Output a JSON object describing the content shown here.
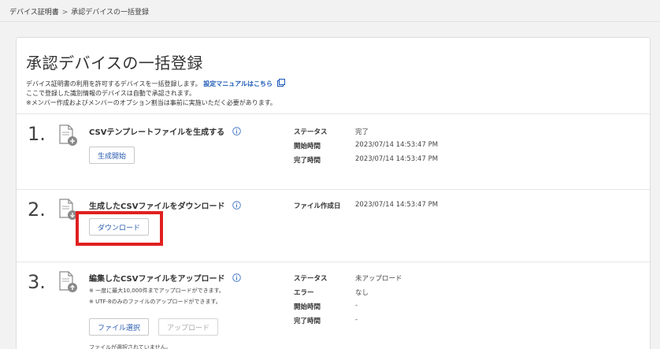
{
  "breadcrumb": {
    "parent": "デバイス証明書",
    "separator": ">",
    "current": "承認デバイスの一括登録"
  },
  "page": {
    "title": "承認デバイスの一括登録",
    "desc_line1": "デバイス証明書の利用を許可するデバイスを一括登録します。",
    "manual_link": "設定マニュアルはこちら",
    "desc_line2": "ここで登録した識別情報のデバイスは自動で承認されます。",
    "desc_line3": "※メンバー作成およびメンバーのオプション割当は事前に実施いただく必要があります。"
  },
  "steps": [
    {
      "number": "1.",
      "title": "CSVテンプレートファイルを生成する",
      "button": "生成開始",
      "fields": [
        {
          "label": "ステータス",
          "value": "完了"
        },
        {
          "label": "開始時間",
          "value": "2023/07/14 14:53:47 PM"
        },
        {
          "label": "完了時間",
          "value": "2023/07/14 14:53:47 PM"
        }
      ]
    },
    {
      "number": "2.",
      "title": "生成したCSVファイルをダウンロード",
      "button": "ダウンロード",
      "fields": [
        {
          "label": "ファイル作成日",
          "value": "2023/07/14 14:53:47 PM"
        }
      ]
    },
    {
      "number": "3.",
      "title": "編集したCSVファイルをアップロード",
      "note1": "※ 一度に最大10,000件までアップロードができます。",
      "note2": "※ UTF-8のみのファイルのアップロードができます。",
      "button_select": "ファイル選択",
      "button_upload": "アップロード",
      "no_file": "ファイルが選択されていません。",
      "fields": [
        {
          "label": "ステータス",
          "value": "未アップロード"
        },
        {
          "label": "エラー",
          "value": "なし"
        },
        {
          "label": "開始時間",
          "value": "-"
        },
        {
          "label": "完了時間",
          "value": "-"
        }
      ]
    }
  ],
  "colors": {
    "link": "#1a57b8",
    "highlight": "#e02020",
    "info_icon": "#3a6fc4"
  }
}
